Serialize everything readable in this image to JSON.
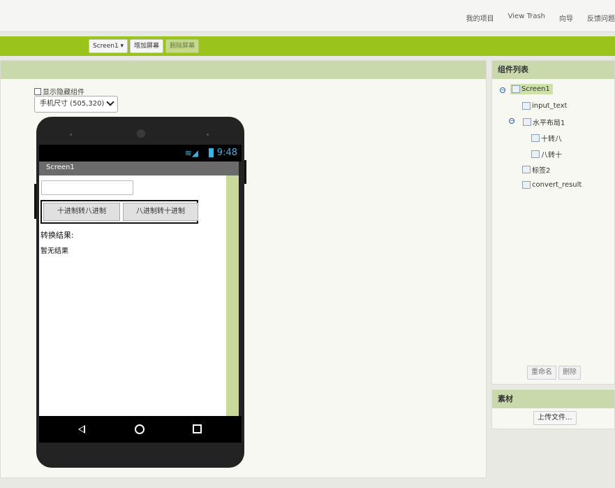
{
  "topnav": {
    "links": [
      "我的项目",
      "View Trash",
      "向导",
      "反馈问题"
    ]
  },
  "toolbar": {
    "screen_select": "Screen1 ▾",
    "add_screen": "增加屏幕",
    "remove_screen": "删除屏幕"
  },
  "viewer": {
    "hide_components_label": "显示隐藏组件",
    "phone_size": "手机尺寸 (505,320)",
    "status_time": "9:48",
    "screen_title": "Screen1",
    "buttons": [
      "十进制转八进制",
      "八进制转十进制"
    ],
    "label2": "转换结果:",
    "result": "暂无结果"
  },
  "components": {
    "title": "组件列表",
    "tree": [
      "Screen1",
      "input_text",
      "水平布局1",
      "十转八",
      "八转十",
      "标签2",
      "convert_result"
    ],
    "rename": "重命名",
    "delete": "删除"
  },
  "media": {
    "title": "素材",
    "upload": "上传文件..."
  }
}
